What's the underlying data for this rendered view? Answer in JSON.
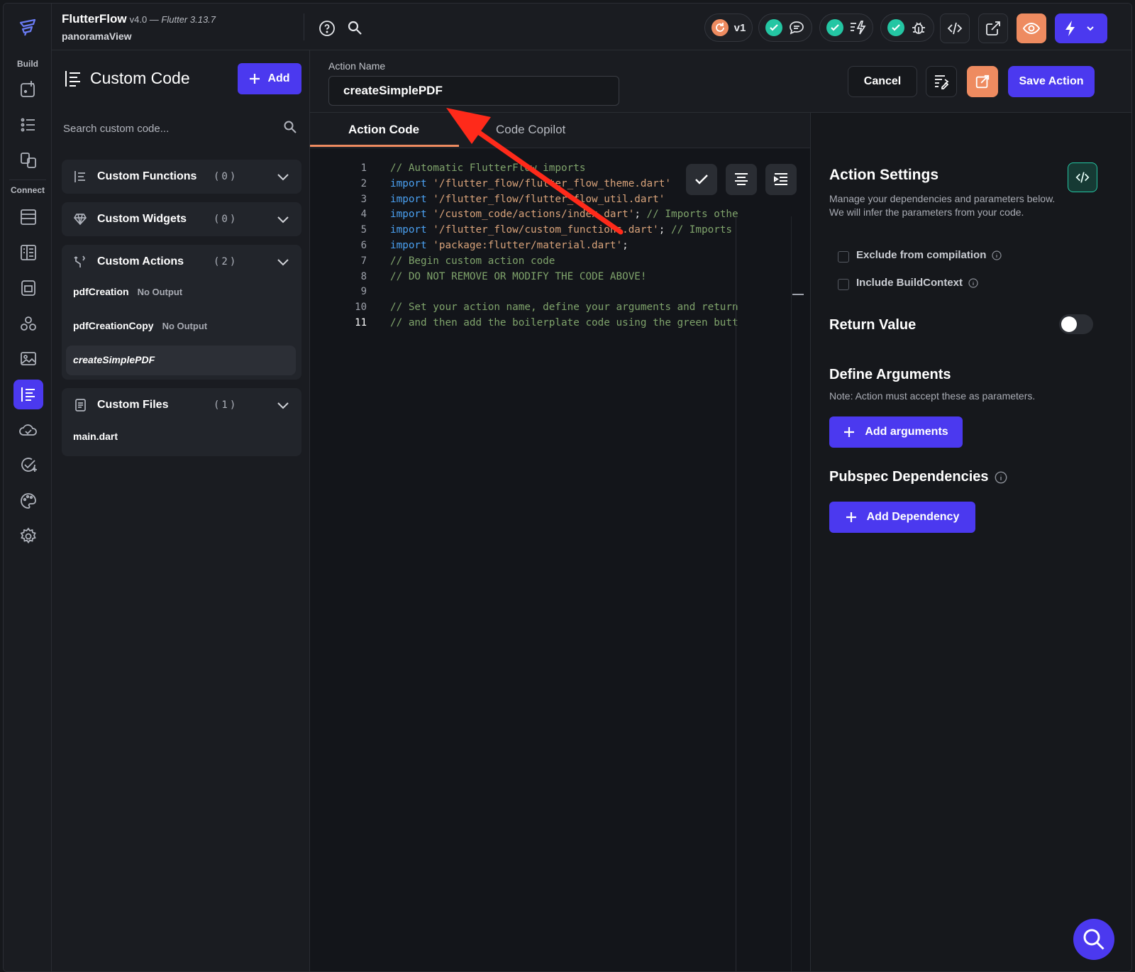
{
  "app": {
    "name": "FlutterFlow",
    "version": "v4.0 —",
    "flutter_version": "Flutter 3.13.7",
    "project": "panoramaView"
  },
  "rail": {
    "build_label": "Build",
    "connect_label": "Connect"
  },
  "toolbar": {
    "version_badge": "v1"
  },
  "panel": {
    "title": "Custom Code",
    "add_label": "Add",
    "search_placeholder": "Search custom code...",
    "groups": [
      {
        "label": "Custom Functions",
        "count": "(0)",
        "items": []
      },
      {
        "label": "Custom Widgets",
        "count": "(0)",
        "items": []
      },
      {
        "label": "Custom Actions",
        "count": "(2)",
        "items": [
          {
            "name": "pdfCreation",
            "output": "No Output"
          },
          {
            "name": "pdfCreationCopy",
            "output": "No Output"
          },
          {
            "name": "createSimplePDF",
            "output": ""
          }
        ]
      },
      {
        "label": "Custom Files",
        "count": "(1)",
        "items": [
          {
            "name": "main.dart"
          }
        ]
      }
    ]
  },
  "editor": {
    "action_name_label": "Action Name",
    "action_name_value": "createSimplePDF",
    "cancel_label": "Cancel",
    "save_label": "Save Action",
    "tabs": [
      "Action Code",
      "Code Copilot"
    ],
    "lines": [
      {
        "n": "1",
        "parts": [
          {
            "t": "// Automatic FlutterFlow imports",
            "c": "com"
          }
        ]
      },
      {
        "n": "2",
        "parts": [
          {
            "t": "import ",
            "c": "kw"
          },
          {
            "t": "'/flutter_flow/flutter_flow_theme.dart'",
            "c": "str"
          }
        ]
      },
      {
        "n": "3",
        "parts": [
          {
            "t": "import ",
            "c": "kw"
          },
          {
            "t": "'/flutter_flow/flutter_flow_util.dart'",
            "c": "str"
          }
        ]
      },
      {
        "n": "4",
        "parts": [
          {
            "t": "import ",
            "c": "kw"
          },
          {
            "t": "'/custom_code/actions/index.dart'",
            "c": "str"
          },
          {
            "t": "; ",
            "c": "pun"
          },
          {
            "t": "// Imports other custom actions",
            "c": "com"
          }
        ]
      },
      {
        "n": "5",
        "parts": [
          {
            "t": "import ",
            "c": "kw"
          },
          {
            "t": "'/flutter_flow/custom_functions.dart'",
            "c": "str"
          },
          {
            "t": "; ",
            "c": "pun"
          },
          {
            "t": "// Imports custom functions",
            "c": "com"
          }
        ]
      },
      {
        "n": "6",
        "parts": [
          {
            "t": "import ",
            "c": "kw"
          },
          {
            "t": "'package:flutter/material.dart'",
            "c": "str"
          },
          {
            "t": ";",
            "c": "pun"
          }
        ]
      },
      {
        "n": "7",
        "parts": [
          {
            "t": "// Begin custom action code",
            "c": "com"
          }
        ]
      },
      {
        "n": "8",
        "parts": [
          {
            "t": "// DO NOT REMOVE OR MODIFY THE CODE ABOVE!",
            "c": "com"
          }
        ]
      },
      {
        "n": "9",
        "parts": [
          {
            "t": "",
            "c": "com"
          }
        ]
      },
      {
        "n": "10",
        "parts": [
          {
            "t": "// Set your action name, define your arguments and return parameter,",
            "c": "com"
          }
        ]
      },
      {
        "n": "11",
        "parts": [
          {
            "t": "// and then add the boilerplate code using the green button on the right!",
            "c": "com"
          }
        ]
      }
    ]
  },
  "settings": {
    "title": "Action Settings",
    "desc1": "Manage your dependencies and parameters below.",
    "desc2": "We will infer the parameters from your code.",
    "exclude_label": "Exclude from compilation",
    "context_label": "Include BuildContext",
    "return_label": "Return Value",
    "return_enabled": false,
    "args_title": "Define Arguments",
    "args_note": "Note: Action must accept these as parameters.",
    "add_args_label": "Add arguments",
    "deps_title": "Pubspec Dependencies",
    "add_dep_label": "Add Dependency"
  },
  "colors": {
    "accent": "#4B39EF",
    "tab_underline": "#EE8B60",
    "success": "#24C6A3",
    "arrow": "#FF2A1A"
  }
}
